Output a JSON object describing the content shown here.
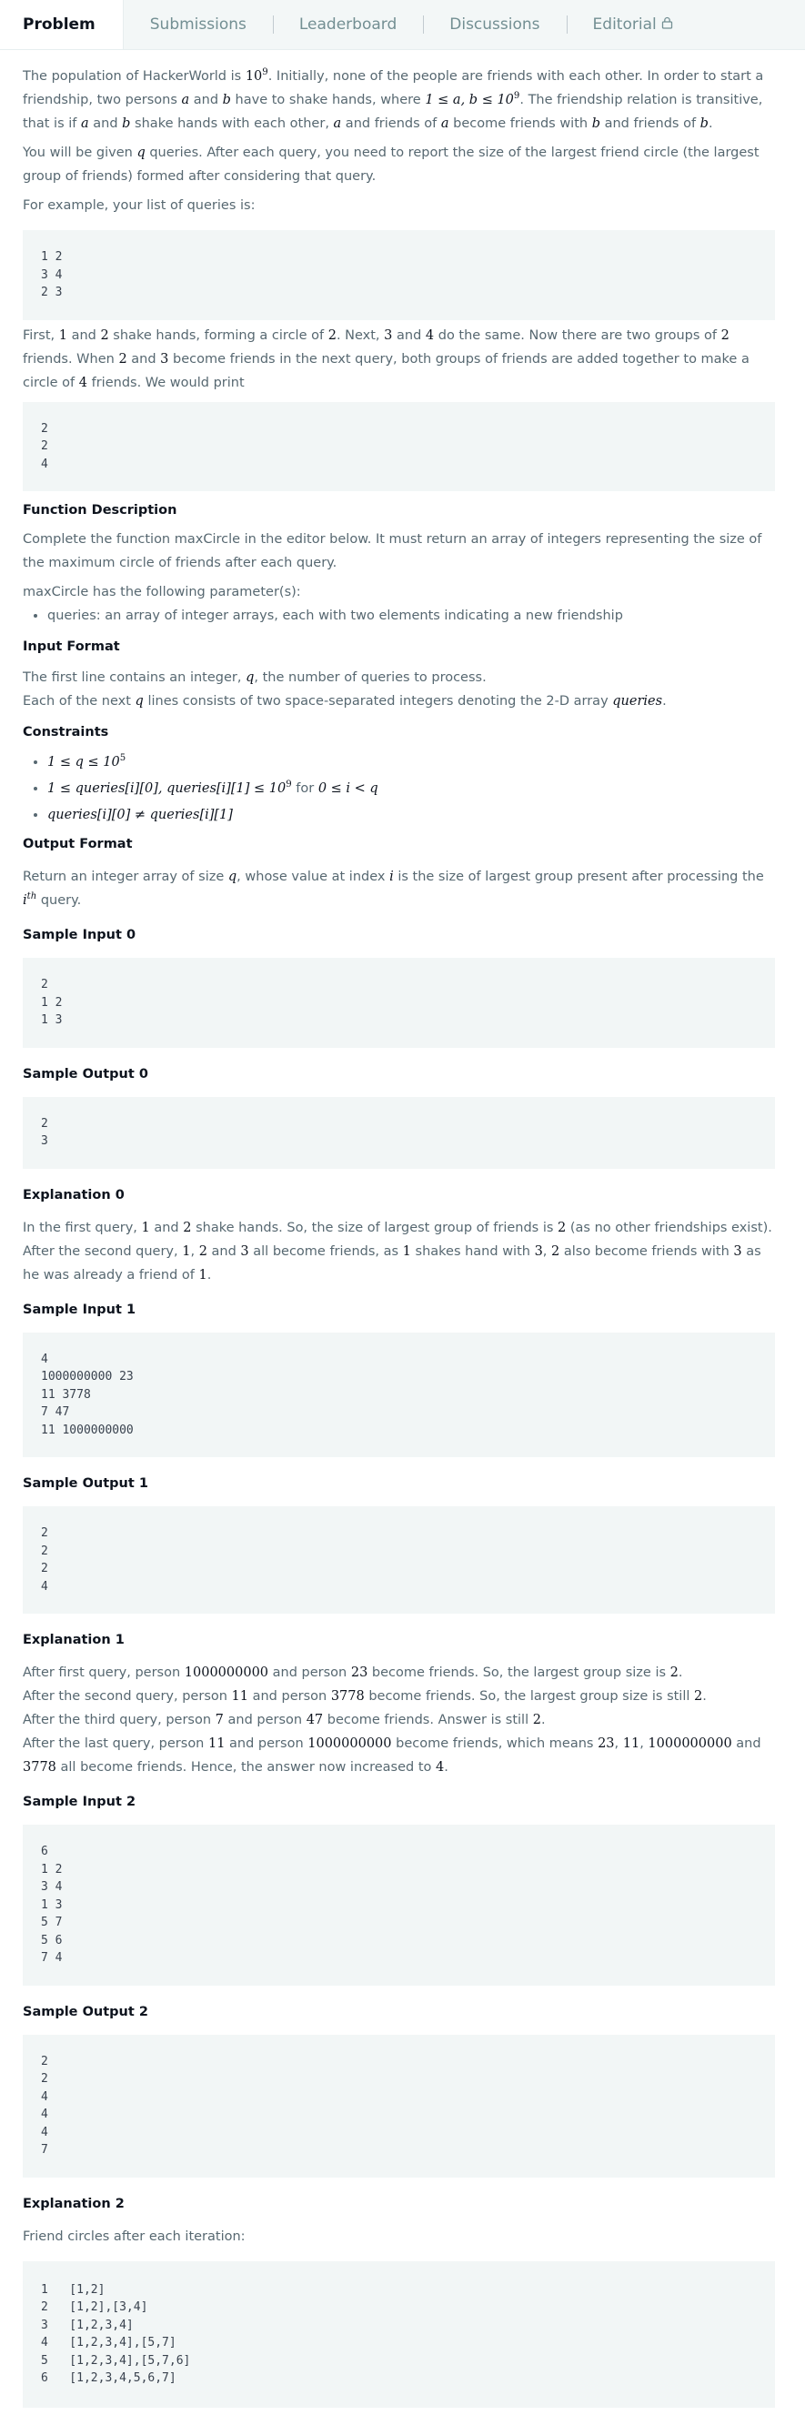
{
  "tabs": [
    {
      "label": "Problem"
    },
    {
      "label": "Submissions"
    },
    {
      "label": "Leaderboard"
    },
    {
      "label": "Discussions"
    },
    {
      "label": "Editorial"
    }
  ],
  "intro": {
    "t1": "The population of HackerWorld is ",
    "pop_base": "10",
    "pop_exp": "9",
    "t2": ". Initially, none of the people are friends with each other. In order to start a friendship, two persons ",
    "a": "a",
    "and": " and ",
    "b": "b",
    "t3": " have to shake hands, where ",
    "cond": "1 ≤ a, b ≤ 10",
    "cond_exp": "9",
    "t4": ". The friendship relation is transitive, that is if ",
    "t5": " shake hands with each other, ",
    "t6": " and friends of ",
    "t7": " become friends with ",
    "t8": " and friends of ",
    "t9": "."
  },
  "queries_para": {
    "t1": "You will be given ",
    "q": "q",
    "t2": " queries. After each query, you need to report the size of the largest friend circle (the largest group of friends) formed after considering that query."
  },
  "example_intro": "For example, your list of queries is:",
  "example_input": "1 2\n3 4\n2 3",
  "first_para": {
    "t1": "First, ",
    "n1": "1",
    "t2": " and ",
    "n2": "2",
    "t3": " shake hands, forming a circle of ",
    "n3": "2",
    "t4": ". Next, ",
    "n4": "3",
    "t5": " and ",
    "n5": "4",
    "t6": " do the same. Now there are two groups of ",
    "n6": "2",
    "t7": " friends. When ",
    "n7": "2",
    "t8": " and ",
    "n8": "3",
    "t9": " become friends in the next query, both groups of friends are added together to make a circle of ",
    "n9": "4",
    "t10": " friends. We would print"
  },
  "example_output": "2\n2\n4",
  "func_desc": {
    "heading": "Function Description",
    "p1": "Complete the function maxCircle in the editor below. It must return an array of integers representing the size of the maximum circle of friends after each query.",
    "p2": "maxCircle has the following parameter(s):",
    "li1": "queries: an array of integer arrays, each with two elements indicating a new friendship"
  },
  "input_format": {
    "heading": "Input Format",
    "p1a": "The first line contains an integer, ",
    "p1b": ", the number of queries to process.",
    "p2a": "Each of the next ",
    "p2b": " lines consists of two space-separated integers denoting the 2-D array ",
    "p2c": "queries",
    "p2d": "."
  },
  "constraints": {
    "heading": "Constraints",
    "c1": "1 ≤ q ≤ 10",
    "c1_exp": "5",
    "c2": "1 ≤ queries[i][0], queries[i][1] ≤ 10",
    "c2_exp": "9",
    "c2_for": " for ",
    "c2_range": "0 ≤ i < q",
    "c3": "queries[i][0] ≠ queries[i][1]"
  },
  "output_format": {
    "heading": "Output Format",
    "t1": "Return an integer array of size ",
    "t2": ", whose value at index ",
    "i": "i",
    "t3": " is the size of largest group present after processing the ",
    "th": "th",
    "t4": " query."
  },
  "sample_input_0": {
    "heading": "Sample Input 0",
    "code": "2\n1 2\n1 3"
  },
  "sample_output_0": {
    "heading": "Sample Output 0",
    "code": "2\n3"
  },
  "explanation_0": {
    "heading": "Explanation 0",
    "l1": [
      "In the first query, ",
      "1",
      " and ",
      "2",
      " shake hands. So, the size of largest group of friends is ",
      "2",
      " (as no other friendships exist)."
    ],
    "l2": [
      "After the second query, ",
      "1",
      ", ",
      "2",
      " and ",
      "3",
      " all become friends, as ",
      "1",
      " shakes hand with ",
      "3",
      ", ",
      "2",
      " also become friends with ",
      "3",
      " as he was already a friend of ",
      "1",
      "."
    ]
  },
  "sample_input_1": {
    "heading": "Sample Input 1",
    "code": "4\n1000000000 23\n11 3778\n7 47\n11 1000000000"
  },
  "sample_output_1": {
    "heading": "Sample Output 1",
    "code": "2\n2\n2\n4"
  },
  "explanation_1": {
    "heading": "Explanation 1",
    "l1": [
      "After first query, person ",
      "1000000000",
      " and person ",
      "23",
      " become friends. So, the largest group size is ",
      "2",
      "."
    ],
    "l2": [
      "After the second query, person ",
      "11",
      " and person ",
      "3778",
      " become friends. So, the largest group size is still ",
      "2",
      "."
    ],
    "l3": [
      "After the third query, person ",
      "7",
      " and person ",
      "47",
      " become friends. Answer is still ",
      "2",
      "."
    ],
    "l4": [
      "After the last query, person ",
      "11",
      " and person ",
      "1000000000",
      " become friends, which means ",
      "23",
      ", ",
      "11",
      ", ",
      "1000000000",
      " and ",
      "3778",
      " all become friends. Hence, the answer now increased to ",
      "4",
      "."
    ]
  },
  "sample_input_2": {
    "heading": "Sample Input 2",
    "code": "6\n1 2\n3 4\n1 3\n5 7\n5 6\n7 4"
  },
  "sample_output_2": {
    "heading": "Sample Output 2",
    "code": "2\n2\n4\n4\n4\n7"
  },
  "explanation_2": {
    "heading": "Explanation 2",
    "p1": "Friend circles after each iteration:",
    "code": "1   [1,2]\n2   [1,2],[3,4]\n3   [1,2,3,4]\n4   [1,2,3,4],[5,7]\n5   [1,2,3,4],[5,7,6]\n6   [1,2,3,4,5,6,7]"
  }
}
